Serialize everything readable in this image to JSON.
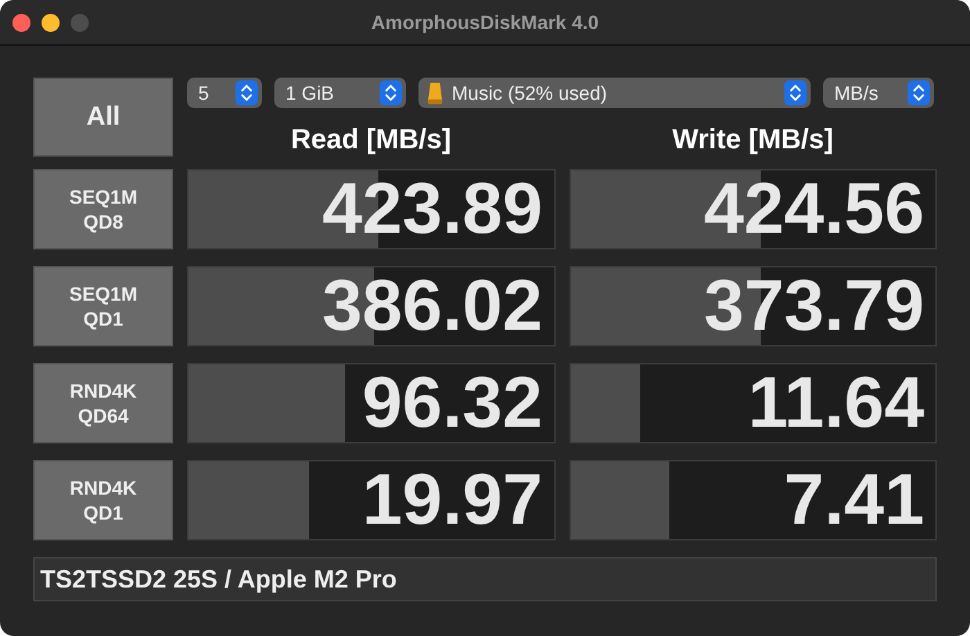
{
  "window": {
    "title": "AmorphousDiskMark 4.0"
  },
  "all_button": "All",
  "selectors": [
    {
      "kind": "plain",
      "value": "5"
    },
    {
      "kind": "plain",
      "value": "1 GiB"
    },
    {
      "kind": "drive",
      "value": "Music (52% used)"
    },
    {
      "kind": "plain",
      "value": "MB/s"
    }
  ],
  "columns": [
    "Read [MB/s]",
    "Write [MB/s]"
  ],
  "tests": [
    {
      "label": [
        "SEQ1M",
        "QD8"
      ],
      "read": {
        "value": "423.89",
        "level": 0.52
      },
      "write": {
        "value": "424.56",
        "level": 0.52
      }
    },
    {
      "label": [
        "SEQ1M",
        "QD1"
      ],
      "read": {
        "value": "386.02",
        "level": 0.51
      },
      "write": {
        "value": "373.79",
        "level": 0.52
      }
    },
    {
      "label": [
        "RND4K",
        "QD64"
      ],
      "read": {
        "value": "96.32",
        "level": 0.43
      },
      "write": {
        "value": "11.64",
        "level": 0.19
      }
    },
    {
      "label": [
        "RND4K",
        "QD1"
      ],
      "read": {
        "value": "19.97",
        "level": 0.33
      },
      "write": {
        "value": "7.41",
        "level": 0.27
      }
    }
  ],
  "footer": "TS2TSSD2 25S / Apple M2 Pro"
}
